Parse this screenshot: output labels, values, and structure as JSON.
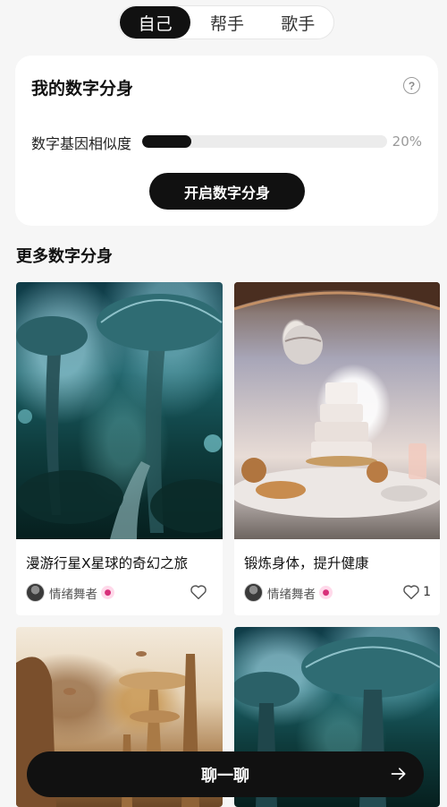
{
  "tabs": [
    {
      "label": "自己",
      "active": true
    },
    {
      "label": "帮手",
      "active": false
    },
    {
      "label": "歌手",
      "active": false
    }
  ],
  "twin_card": {
    "title": "我的数字分身",
    "help_icon": "question-circle-icon",
    "similarity_label": "数字基因相似度",
    "similarity_percent": 20,
    "similarity_text": "20%",
    "start_button": "开启数字分身"
  },
  "section": {
    "title": "更多数字分身"
  },
  "cards": [
    {
      "title": "漫游行星X星球的奇幻之旅",
      "author": "情绪舞者",
      "likes": "",
      "image": "alien-mushroom-forest-path"
    },
    {
      "title": "锻炼身体，提升健康",
      "author": "情绪舞者",
      "likes": "1",
      "image": "cake-on-table-with-planet"
    },
    {
      "title": "",
      "author": "",
      "likes": "",
      "image": "golden-futuristic-city"
    },
    {
      "title": "",
      "author": "",
      "likes": "",
      "image": "alien-mushroom-forest"
    }
  ],
  "chat_bar": {
    "label": "聊一聊",
    "icon": "arrow-right-icon"
  },
  "colors": {
    "accent": "#111111",
    "background": "#f6f6f6",
    "card": "#ffffff"
  }
}
